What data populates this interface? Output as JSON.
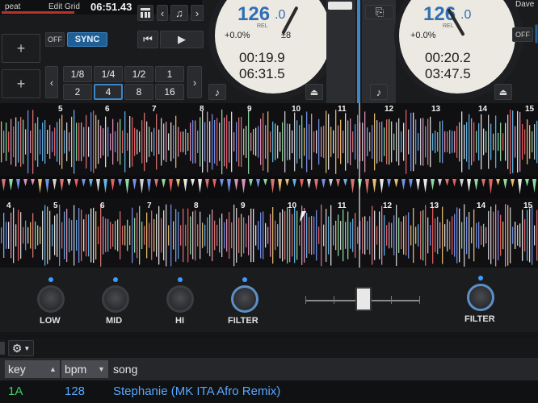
{
  "top": {
    "repeat_label": "peat",
    "edit_grid_label": "Edit Grid",
    "clock": "06:51.43",
    "off_label": "OFF",
    "sync_label": "SYNC",
    "loop_values": [
      "1/8",
      "1/4",
      "1/2",
      "1",
      "2",
      "4",
      "8",
      "16"
    ],
    "loop_selected": "4"
  },
  "deck_left": {
    "bpm": "126",
    "bpm_decimal": ".0",
    "rel_label": "REL",
    "pitch": "+0.0%",
    "range": "±8",
    "elapsed": "00:19.9",
    "remaining": "06:31.5"
  },
  "deck_right": {
    "name": "Dave",
    "bpm": "126",
    "bpm_decimal": ".0",
    "rel_label": "REL",
    "pitch": "+0.0%",
    "elapsed": "00:20.2",
    "remaining": "03:47.5",
    "off_label": "OFF"
  },
  "waveform": {
    "upper_markers": [
      "5",
      "6",
      "7",
      "8",
      "9",
      "10",
      "11",
      "12",
      "13",
      "14",
      "15"
    ],
    "lower_markers": [
      "4",
      "5",
      "6",
      "7",
      "8",
      "9",
      "10",
      "11",
      "12",
      "13",
      "14",
      "15"
    ]
  },
  "mixer": {
    "knobs": [
      "LOW",
      "MID",
      "HI",
      "FILTER"
    ],
    "right_knob": "FILTER"
  },
  "library": {
    "columns": {
      "key": "key",
      "bpm": "bpm",
      "song": "song"
    },
    "row": {
      "key": "1A",
      "bpm": "128",
      "song": "Stephanie (MK ITA Afro Remix)"
    }
  },
  "colors": {
    "accent_blue": "#2f6fb2",
    "sync_blue": "#1f5f95",
    "key_green": "#3ecf6a",
    "song_blue": "#5aa7ff"
  }
}
